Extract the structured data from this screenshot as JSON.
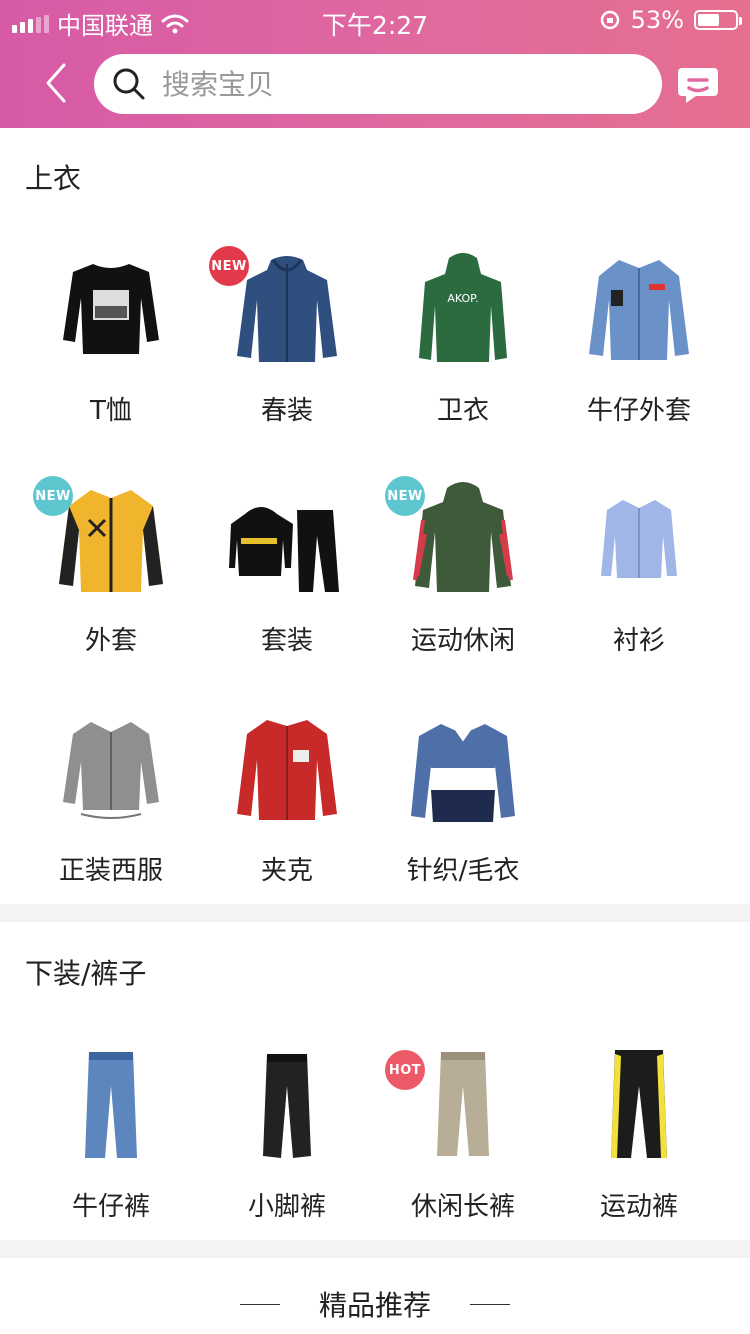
{
  "status_bar": {
    "carrier": "中国联通",
    "time": "下午2:27",
    "battery_percent": "53%",
    "battery_level": 0.53
  },
  "header": {
    "search_placeholder": "搜索宝贝",
    "gradient_colors": [
      "#d75aa6",
      "#e66f8f"
    ]
  },
  "sections": [
    {
      "title": "上衣",
      "items": [
        {
          "label": "T恤",
          "icon": "tshirt-image"
        },
        {
          "label": "春装",
          "icon": "spring-jacket-image",
          "badge": "NEW",
          "badge_color": "#e2394b"
        },
        {
          "label": "卫衣",
          "icon": "hoodie-image"
        },
        {
          "label": "牛仔外套",
          "icon": "denim-jacket-image"
        },
        {
          "label": "外套",
          "icon": "coat-image",
          "badge": "NEW",
          "badge_color": "#5ec6cf"
        },
        {
          "label": "套装",
          "icon": "tracksuit-image"
        },
        {
          "label": "运动休闲",
          "icon": "sport-hoodie-image",
          "badge": "NEW",
          "badge_color": "#5ec6cf"
        },
        {
          "label": "衬衫",
          "icon": "shirt-image"
        },
        {
          "label": "正装西服",
          "icon": "suit-image"
        },
        {
          "label": "夹克",
          "icon": "bomber-jacket-image"
        },
        {
          "label": "针织/毛衣",
          "icon": "sweater-image"
        }
      ]
    },
    {
      "title": "下装/裤子",
      "items": [
        {
          "label": "牛仔裤",
          "icon": "jeans-image"
        },
        {
          "label": "小脚裤",
          "icon": "slim-pants-image"
        },
        {
          "label": "休闲长裤",
          "icon": "chinos-image",
          "badge": "HOT",
          "badge_color": "#ec5a68"
        },
        {
          "label": "运动裤",
          "icon": "track-pants-image"
        }
      ]
    }
  ],
  "recommend": {
    "title": "精品推荐"
  }
}
